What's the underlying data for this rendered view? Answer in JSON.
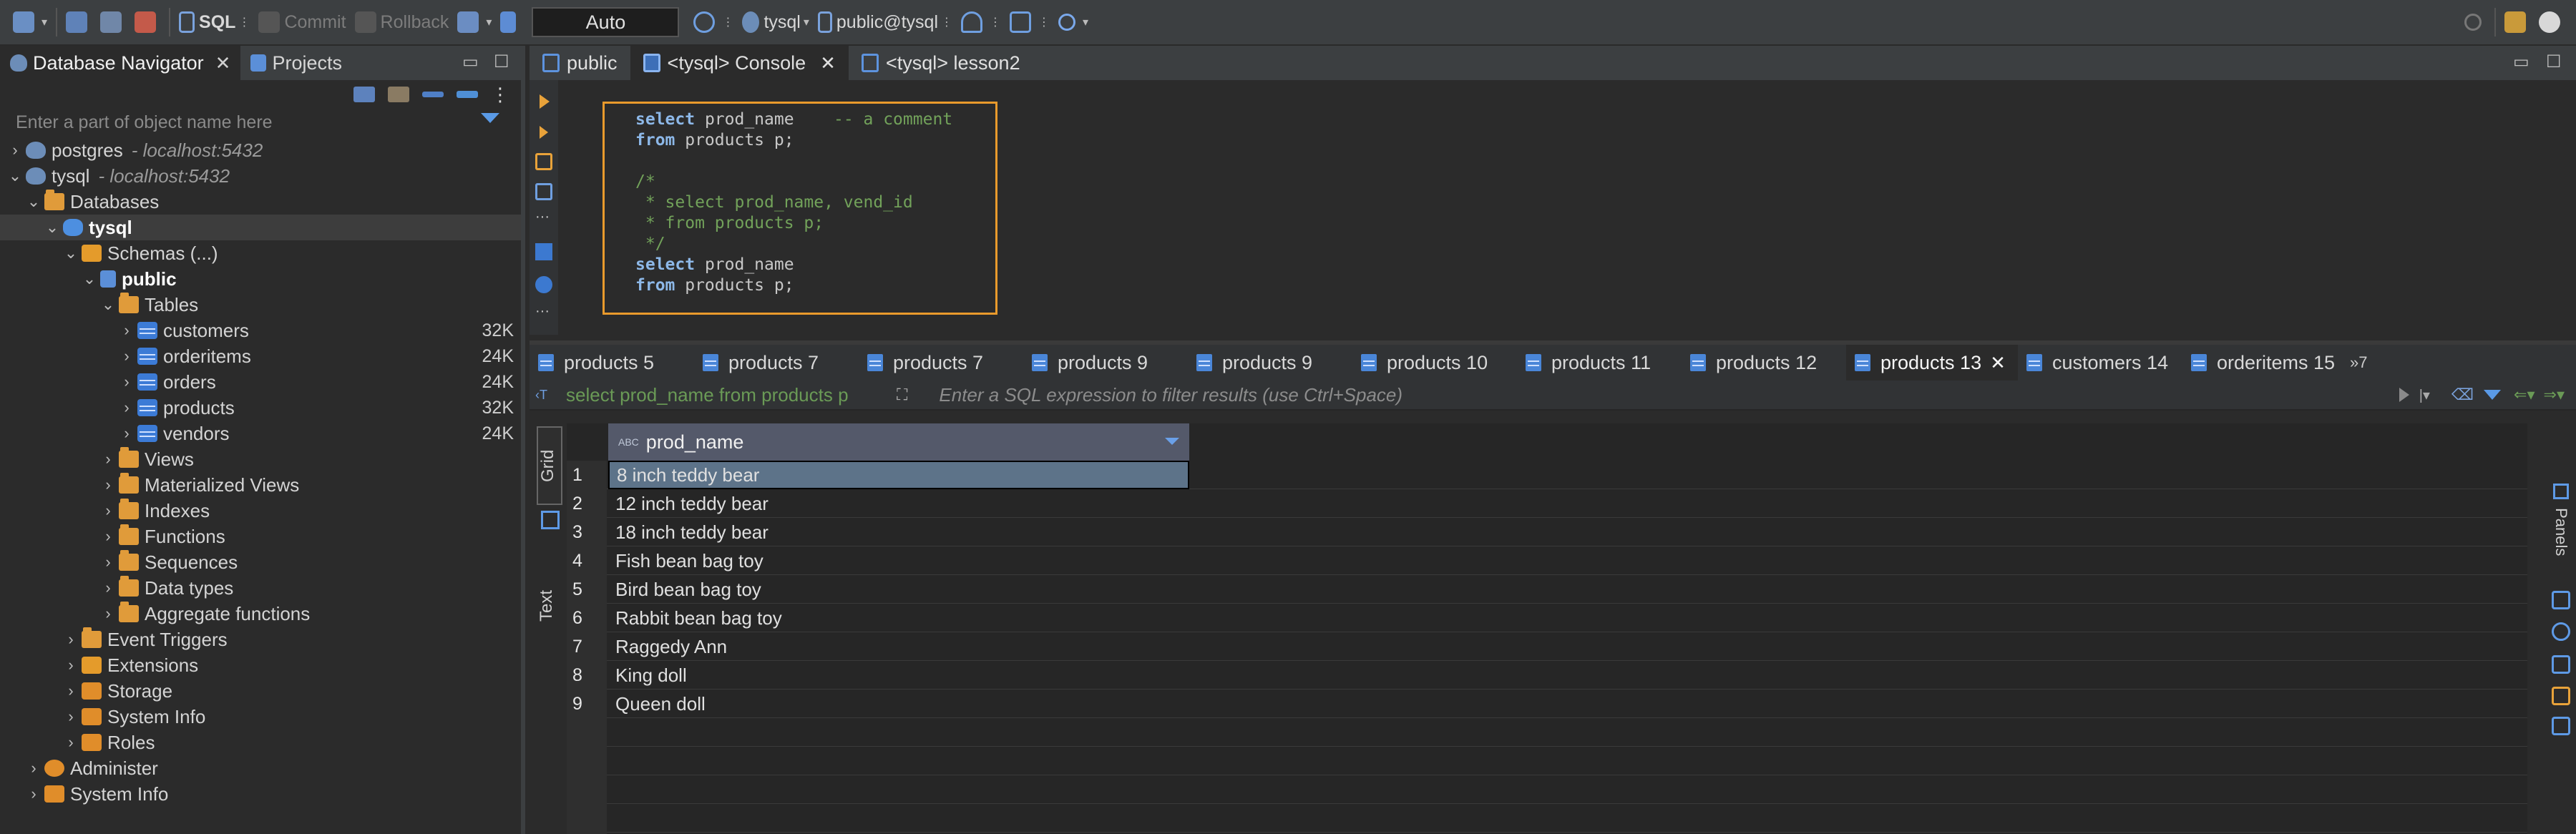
{
  "toolbar": {
    "sql_label": "SQL",
    "commit_label": "Commit",
    "rollback_label": "Rollback",
    "tx_mode": "Auto",
    "datasource": "tysql",
    "schema": "public@tysql"
  },
  "left_panel": {
    "tabs": [
      {
        "label": "Database Navigator"
      },
      {
        "label": "Projects"
      }
    ],
    "filter_placeholder": "Enter a part of object name here",
    "tree": [
      {
        "label": "postgres",
        "host": "- localhost:5432"
      },
      {
        "label": "tysql",
        "host": "- localhost:5432"
      },
      {
        "label": "Databases"
      },
      {
        "label": "tysql"
      },
      {
        "label": "Schemas (...)"
      },
      {
        "label": "public"
      },
      {
        "label": "Tables"
      },
      {
        "label": "customers",
        "size": "32K"
      },
      {
        "label": "orderitems",
        "size": "24K"
      },
      {
        "label": "orders",
        "size": "24K"
      },
      {
        "label": "products",
        "size": "32K"
      },
      {
        "label": "vendors",
        "size": "24K"
      },
      {
        "label": "Views"
      },
      {
        "label": "Materialized Views"
      },
      {
        "label": "Indexes"
      },
      {
        "label": "Functions"
      },
      {
        "label": "Sequences"
      },
      {
        "label": "Data types"
      },
      {
        "label": "Aggregate functions"
      },
      {
        "label": "Event Triggers"
      },
      {
        "label": "Extensions"
      },
      {
        "label": "Storage"
      },
      {
        "label": "System Info"
      },
      {
        "label": "Roles"
      },
      {
        "label": "Administer"
      },
      {
        "label": "System Info"
      }
    ]
  },
  "editor": {
    "tabs": [
      {
        "label": "public"
      },
      {
        "label": "<tysql> Console"
      },
      {
        "label": "<tysql> lesson2"
      }
    ],
    "code": [
      {
        "kw": "select",
        "rest": " prod_name    ",
        "comment": "-- a comment"
      },
      {
        "kw": "from",
        "rest": " products p;",
        "comment": ""
      },
      {
        "kw": "",
        "rest": "",
        "comment": ""
      },
      {
        "kw": "",
        "rest": "",
        "comment": "/*"
      },
      {
        "kw": "",
        "rest": "",
        "comment": " * select prod_name, vend_id"
      },
      {
        "kw": "",
        "rest": "",
        "comment": " * from products p;"
      },
      {
        "kw": "",
        "rest": "",
        "comment": " */"
      },
      {
        "kw": "select",
        "rest": " prod_name",
        "comment": ""
      },
      {
        "kw": "from",
        "rest": " products p;",
        "comment": ""
      }
    ]
  },
  "results": {
    "tabs": [
      {
        "label": "products 5"
      },
      {
        "label": "products 7"
      },
      {
        "label": "products 7"
      },
      {
        "label": "products 9"
      },
      {
        "label": "products 9"
      },
      {
        "label": "products 10"
      },
      {
        "label": "products 11"
      },
      {
        "label": "products 12"
      },
      {
        "label": "products 13"
      },
      {
        "label": "customers 14"
      },
      {
        "label": "orderitems 15"
      }
    ],
    "overflow_label": "»7",
    "filter_sql": "select prod_name from products p",
    "filter_placeholder": "Enter a SQL expression to filter results (use Ctrl+Space)",
    "view_tabs": {
      "grid": "Grid",
      "text": "Text"
    },
    "panels_label": "Panels",
    "column_type_badge": "ABC",
    "columns": [
      "prod_name"
    ],
    "rows": [
      {
        "num": "1",
        "value": "8 inch teddy bear"
      },
      {
        "num": "2",
        "value": "12 inch teddy bear"
      },
      {
        "num": "3",
        "value": "18 inch teddy bear"
      },
      {
        "num": "4",
        "value": "Fish bean bag toy"
      },
      {
        "num": "5",
        "value": "Bird bean bag toy"
      },
      {
        "num": "6",
        "value": "Rabbit bean bag toy"
      },
      {
        "num": "7",
        "value": "Raggedy Ann"
      },
      {
        "num": "8",
        "value": "King doll"
      },
      {
        "num": "9",
        "value": "Queen doll"
      }
    ]
  },
  "colors": {
    "accent": "#e99a2c",
    "keyword": "#8db8e8",
    "comment": "#72a25a",
    "selection": "#5d7389"
  }
}
